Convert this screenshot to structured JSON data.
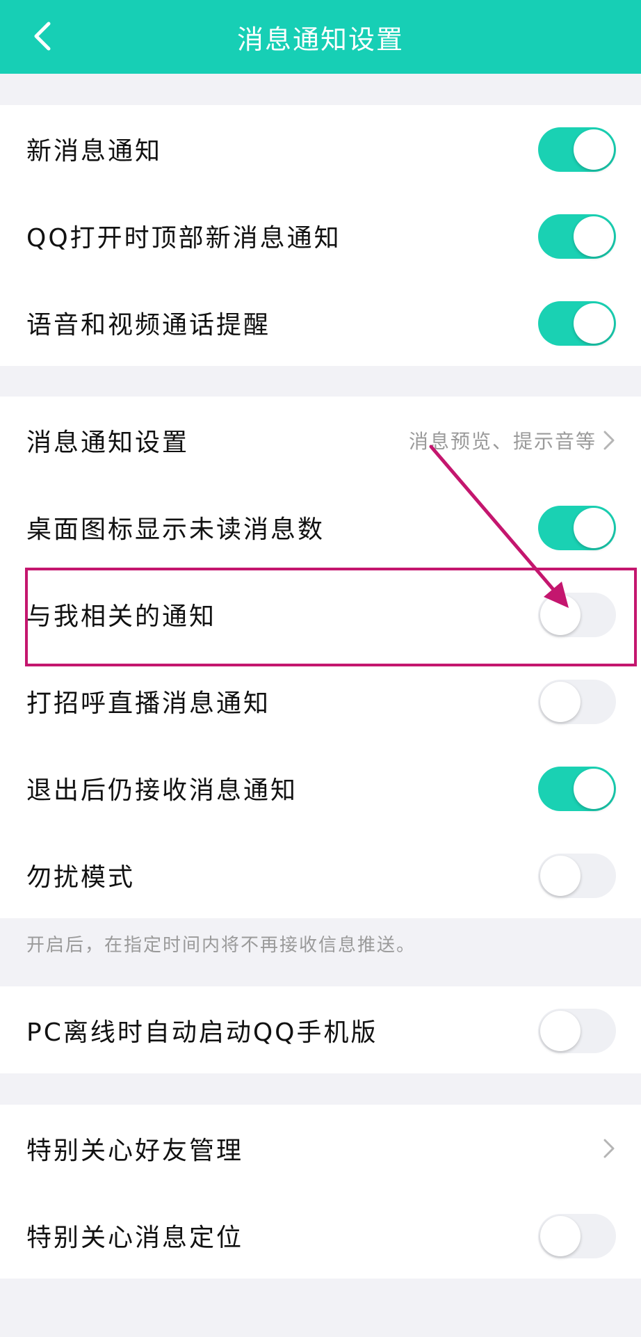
{
  "header": {
    "title": "消息通知设置",
    "back_icon": "chevron-left-icon"
  },
  "group1": [
    {
      "label": "新消息通知",
      "toggle": "on"
    },
    {
      "label": "QQ打开时顶部新消息通知",
      "toggle": "on"
    },
    {
      "label": "语音和视频通话提醒",
      "toggle": "on"
    }
  ],
  "group2": {
    "notify_settings": {
      "label": "消息通知设置",
      "value": "消息预览、提示音等",
      "icon": "chevron-right-icon"
    },
    "items": [
      {
        "label": "桌面图标显示未读消息数",
        "toggle": "on"
      },
      {
        "label": "与我相关的通知",
        "toggle": "off"
      },
      {
        "label": "打招呼直播消息通知",
        "toggle": "off"
      },
      {
        "label": "退出后仍接收消息通知",
        "toggle": "on"
      },
      {
        "label": "勿扰模式",
        "toggle": "off"
      }
    ]
  },
  "dnd_note": "开启后，在指定时间内将不再接收信息推送。",
  "group3": {
    "label": "PC离线时自动启动QQ手机版",
    "toggle": "off"
  },
  "group4": {
    "special_friends": {
      "label": "特别关心好友管理",
      "icon": "chevron-right-icon"
    },
    "special_location": {
      "label": "特别关心消息定位",
      "toggle": "off"
    }
  },
  "colors": {
    "header": "#17cfb5",
    "toggle_on": "#1ad1b3",
    "toggle_off": "#eff0f4",
    "annotation": "#c4166e"
  }
}
